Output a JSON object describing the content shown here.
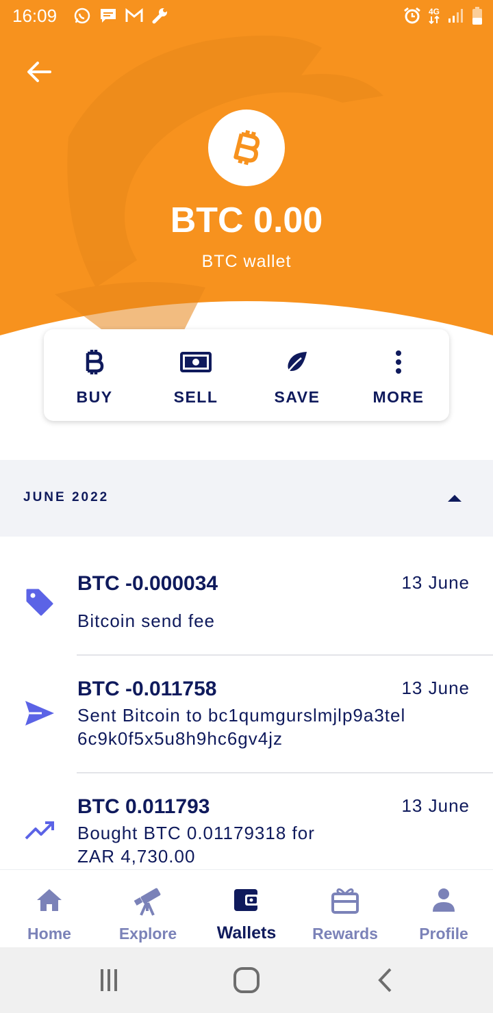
{
  "status_bar": {
    "time": "16:09",
    "network": "4G",
    "left_icons": [
      "whatsapp-icon",
      "message-icon",
      "gmail-icon",
      "wrench-icon"
    ],
    "right_icons": [
      "alarm-icon",
      "network-4g-icon",
      "signal-icon",
      "battery-icon"
    ]
  },
  "header": {
    "balance": "BTC 0.00",
    "wallet_label": "BTC wallet",
    "color": "#f7921e"
  },
  "actions": [
    {
      "label": "BUY",
      "icon": "bitcoin-icon"
    },
    {
      "label": "SELL",
      "icon": "banknote-icon"
    },
    {
      "label": "SAVE",
      "icon": "leaf-icon"
    },
    {
      "label": "MORE",
      "icon": "more-vertical-icon"
    }
  ],
  "month": {
    "label": "JUNE 2022"
  },
  "transactions": [
    {
      "amount": "BTC -0.000034",
      "date": "13 June",
      "description": "Bitcoin send fee",
      "icon": "tag-icon"
    },
    {
      "amount": "BTC -0.011758",
      "date": "13 June",
      "description_line1": "Sent Bitcoin to bc1qumgurslmjlp9a3tel",
      "description_line2": "6c9k0f5x5u8h9hc6gv4jz",
      "icon": "send-icon"
    },
    {
      "amount": "BTC 0.011793",
      "date": "13 June",
      "description_line1": "Bought BTC 0.01179318 for",
      "description_line2": "ZAR 4,730.00",
      "icon": "trending-up-icon"
    }
  ],
  "bottom_nav": [
    {
      "label": "Home",
      "icon": "home-icon",
      "active": false
    },
    {
      "label": "Explore",
      "icon": "telescope-icon",
      "active": false
    },
    {
      "label": "Wallets",
      "icon": "wallet-icon",
      "active": true
    },
    {
      "label": "Rewards",
      "icon": "gift-icon",
      "active": false
    },
    {
      "label": "Profile",
      "icon": "person-icon",
      "active": false
    }
  ],
  "colors": {
    "accent": "#f7921e",
    "navy": "#0f1a5c",
    "muted": "#7b82b8",
    "icon_blue": "#5b63e6"
  }
}
